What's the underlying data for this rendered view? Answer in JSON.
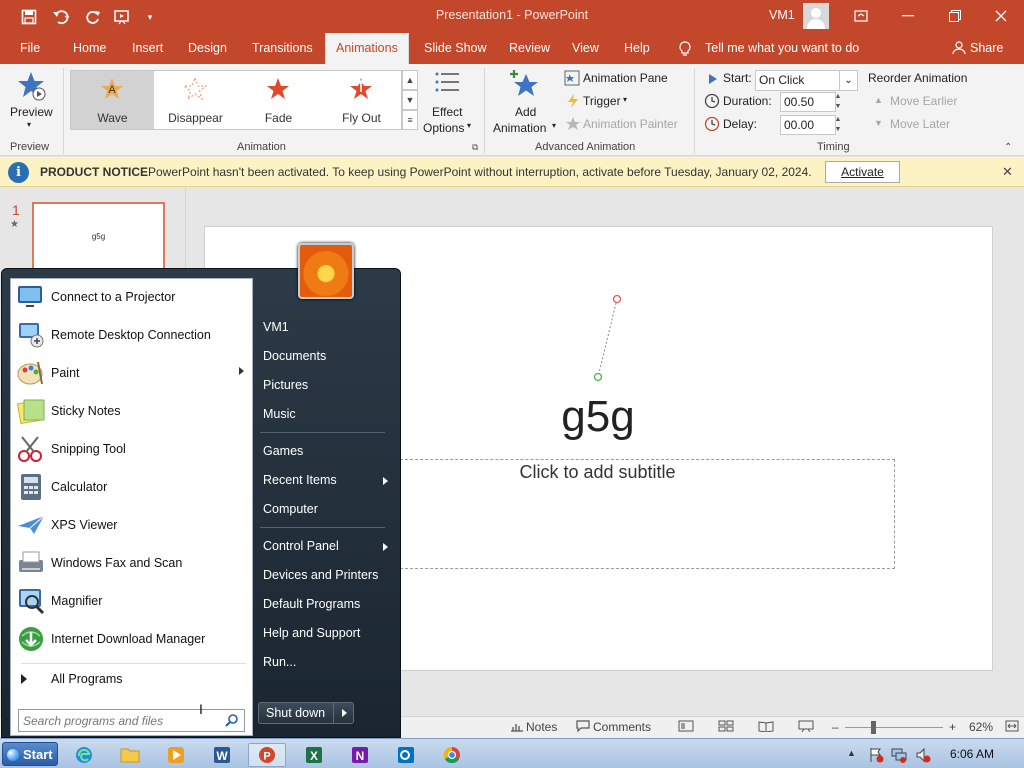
{
  "titlebar": {
    "title": "Presentation1  -  PowerPoint",
    "user": "VM1"
  },
  "tabs": [
    "File",
    "Home",
    "Insert",
    "Design",
    "Transitions",
    "Animations",
    "Slide Show",
    "Review",
    "View",
    "Help"
  ],
  "active_tab": "Animations",
  "tell_me": "Tell me what you want to do",
  "share": "Share",
  "ribbon": {
    "preview": {
      "label": "Preview",
      "group": "Preview"
    },
    "animation_gallery": [
      {
        "label": "Wave",
        "selected": true
      },
      {
        "label": "Disappear"
      },
      {
        "label": "Fade"
      },
      {
        "label": "Fly Out"
      }
    ],
    "effect_options": [
      "Effect",
      "Options"
    ],
    "animation_group": "Animation",
    "add_animation": [
      "Add",
      "Animation"
    ],
    "animation_pane": "Animation Pane",
    "trigger": "Trigger",
    "animation_painter": "Animation Painter",
    "advanced_group": "Advanced Animation",
    "timing": {
      "start_label": "Start:",
      "start_value": "On Click",
      "duration_label": "Duration:",
      "duration_value": "00.50",
      "delay_label": "Delay:",
      "delay_value": "00.00",
      "reorder": "Reorder Animation",
      "move_earlier": "Move Earlier",
      "move_later": "Move Later",
      "group": "Timing"
    }
  },
  "notice": {
    "title": "PRODUCT NOTICE",
    "message": "PowerPoint hasn't been activated. To keep using PowerPoint without interruption, activate before Tuesday, January 02, 2024.",
    "button": "Activate"
  },
  "slides": {
    "number": "1",
    "thumb_text": "g5g"
  },
  "slide": {
    "title": "g5g",
    "subtitle_placeholder": "Click to add subtitle"
  },
  "statusbar": {
    "notes": "Notes",
    "comments": "Comments",
    "zoom": "62%"
  },
  "startmenu": {
    "programs": [
      {
        "label": "Connect to a Projector",
        "icon": "projector-icon"
      },
      {
        "label": "Remote Desktop Connection",
        "icon": "remote-desktop-icon"
      },
      {
        "label": "Paint",
        "icon": "paint-icon",
        "submenu": true
      },
      {
        "label": "Sticky Notes",
        "icon": "sticky-notes-icon"
      },
      {
        "label": "Snipping Tool",
        "icon": "snipping-tool-icon"
      },
      {
        "label": "Calculator",
        "icon": "calculator-icon"
      },
      {
        "label": "XPS Viewer",
        "icon": "xps-viewer-icon"
      },
      {
        "label": "Windows Fax and Scan",
        "icon": "fax-scan-icon"
      },
      {
        "label": "Magnifier",
        "icon": "magnifier-icon"
      },
      {
        "label": "Internet Download Manager",
        "icon": "idm-icon"
      }
    ],
    "all_programs": "All Programs",
    "search_placeholder": "Search programs and files",
    "right": {
      "user": "VM1",
      "documents": "Documents",
      "pictures": "Pictures",
      "music": "Music",
      "games": "Games",
      "recent": "Recent Items",
      "computer": "Computer",
      "control_panel": "Control Panel",
      "devices": "Devices and Printers",
      "defaults": "Default Programs",
      "help": "Help and Support",
      "run": "Run..."
    },
    "shutdown": "Shut down"
  },
  "taskbar": {
    "start": "Start",
    "time": "6:06 AM"
  },
  "colors": {
    "accent": "#c3482b",
    "notice_bg": "#fcf2c4",
    "startmenu_dark": "#1a2530"
  }
}
